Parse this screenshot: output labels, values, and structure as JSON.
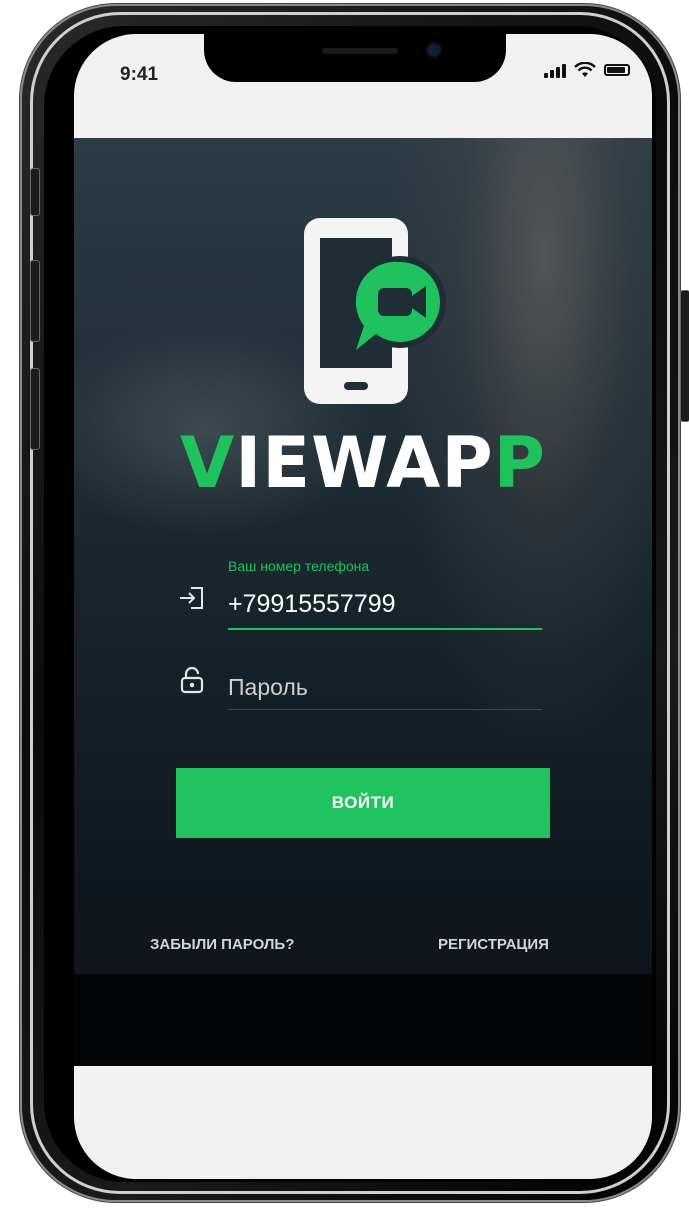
{
  "status_bar": {
    "time": "9:41",
    "icons": [
      "signal-icon",
      "wifi-icon",
      "battery-icon"
    ]
  },
  "app": {
    "brand": {
      "prefix": "V",
      "middle": "IEWAP",
      "suffix": "P"
    },
    "logo_icon": "phone-video-chat-icon",
    "phone_field": {
      "label": "Ваш номер телефона",
      "value": "+79915557799",
      "icon": "login-arrow-icon"
    },
    "password_field": {
      "placeholder": "Пароль",
      "icon": "lock-icon"
    },
    "login_button": "ВОЙТИ",
    "forgot_password": "ЗАБЫЛИ ПАРОЛЬ?",
    "register": "РЕГИСТРАЦИЯ"
  },
  "colors": {
    "accent": "#1fc25d",
    "background_dark": "#152028",
    "text": "#ffffff"
  }
}
